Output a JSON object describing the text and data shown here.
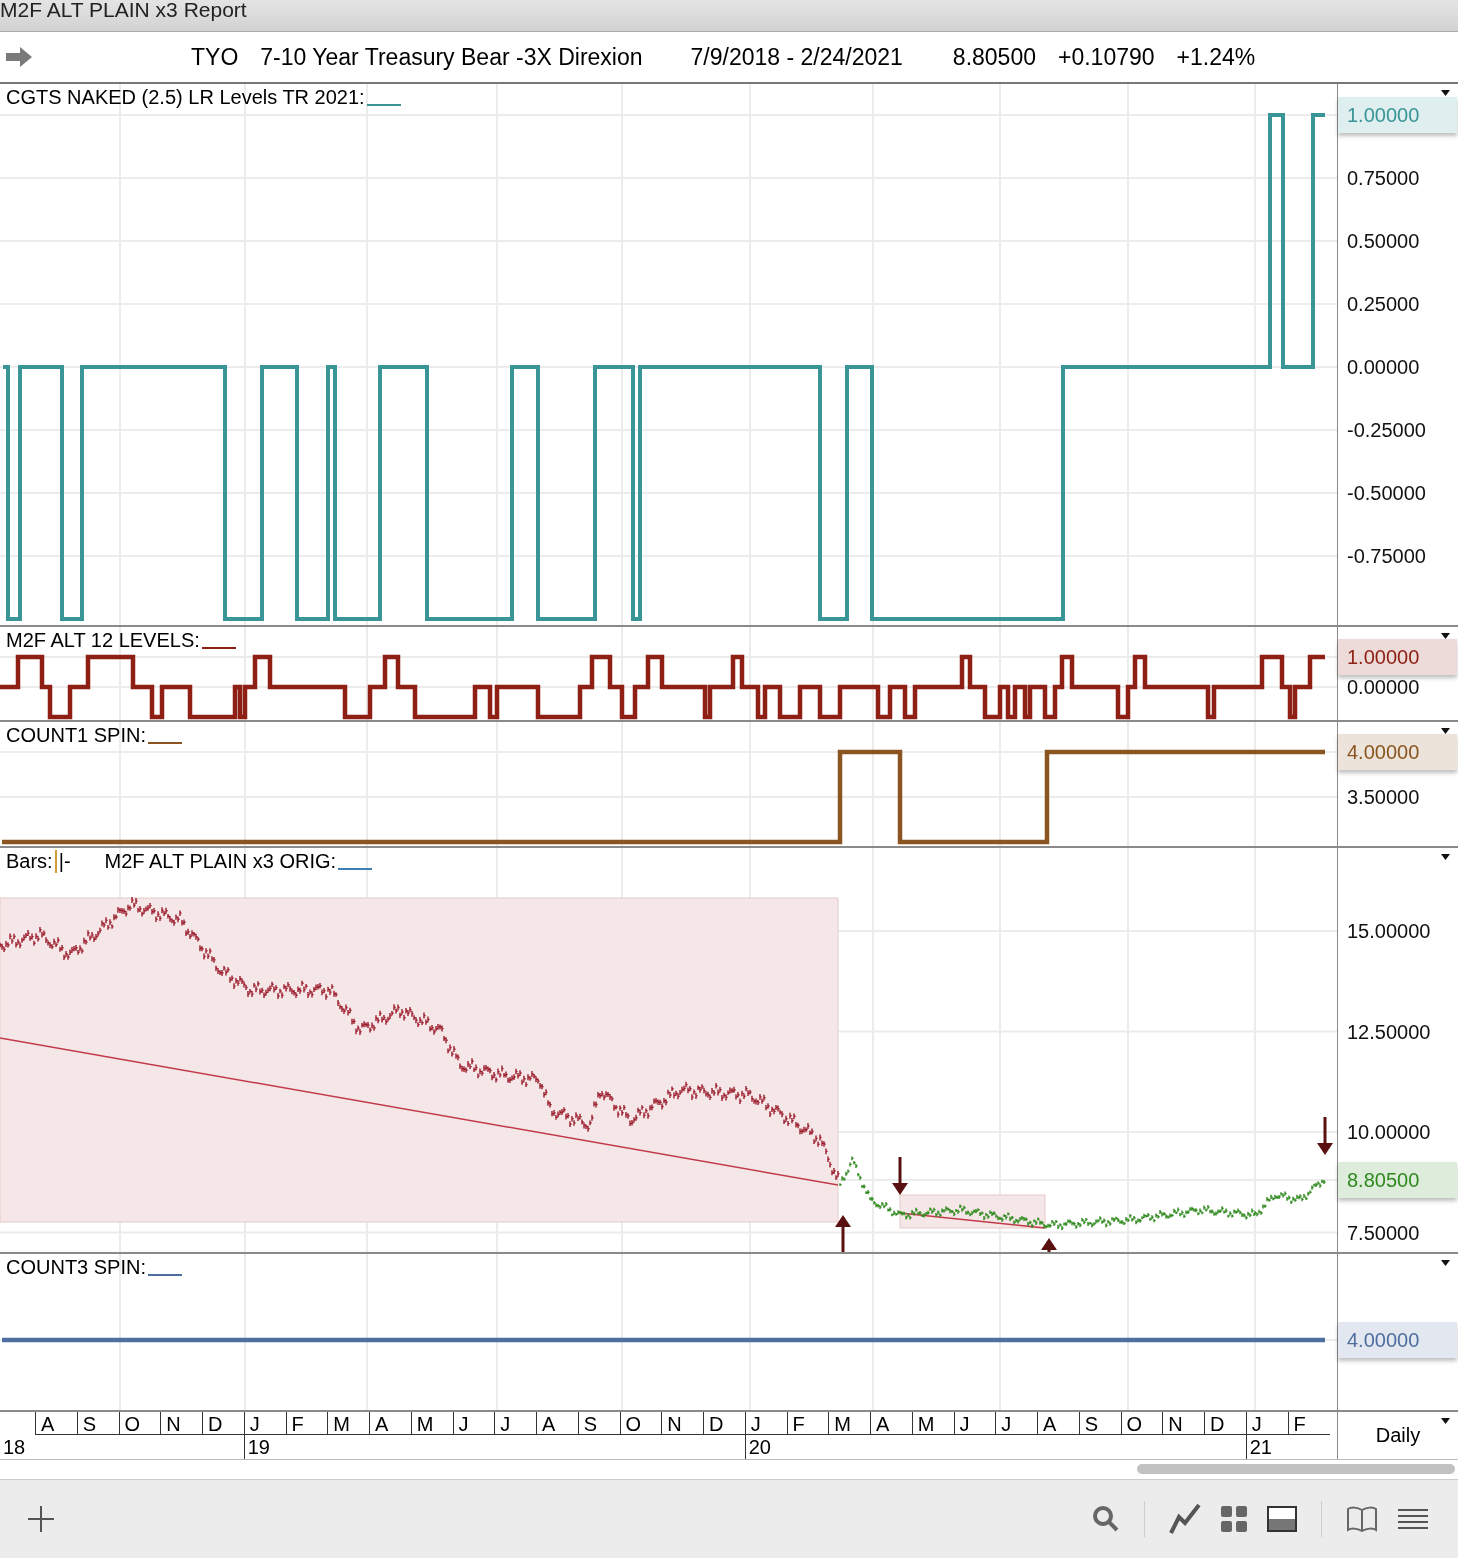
{
  "window": {
    "title": "M2F ALT PLAIN x3 Report"
  },
  "header": {
    "symbol": "TYO",
    "name": "7-10 Year Treasury Bear -3X Direxion",
    "range": "7/9/2018 - 2/24/2021",
    "last": "8.80500",
    "change": "+0.10790",
    "change_pct": "+1.24%"
  },
  "panels": [
    {
      "kind": "step",
      "title": "CGTS NAKED (2.5) LR Levels TR 2021:",
      "color": "#3a9696",
      "ticks": [
        {
          "label": "1.00000",
          "highlighted": true
        },
        {
          "label": "0.75000",
          "highlighted": false
        },
        {
          "label": "0.50000",
          "highlighted": false
        },
        {
          "label": "0.25000",
          "highlighted": false
        },
        {
          "label": "0.00000",
          "highlighted": false
        },
        {
          "label": "-0.25000",
          "highlighted": false
        },
        {
          "label": "-0.50000",
          "highlighted": false
        },
        {
          "label": "-0.75000",
          "highlighted": false
        }
      ]
    },
    {
      "kind": "step",
      "title": "M2F ALT 12 LEVELS:",
      "color": "#8e1f14",
      "ticks": [
        {
          "label": "1.00000",
          "highlighted": true
        },
        {
          "label": "0.00000",
          "highlighted": false
        }
      ]
    },
    {
      "kind": "step",
      "title": "COUNT1 SPIN:",
      "color": "#8a5520",
      "ticks": [
        {
          "label": "4.00000",
          "highlighted": true
        },
        {
          "label": "3.50000",
          "highlighted": false
        }
      ]
    },
    {
      "kind": "price",
      "bars_label": "Bars:",
      "bars_symbol": "|-",
      "title": "M2F ALT PLAIN x3 ORIG:",
      "color": "#3d7fb5",
      "ticks": [
        {
          "label": "15.00000",
          "highlighted": false
        },
        {
          "label": "12.50000",
          "highlighted": false
        },
        {
          "label": "10.00000",
          "highlighted": false
        },
        {
          "label": "8.80500",
          "highlighted": true
        },
        {
          "label": "7.50000",
          "highlighted": false
        }
      ]
    },
    {
      "kind": "step",
      "title": "COUNT3 SPIN:",
      "color": "#4f6ea0",
      "ticks": [
        {
          "label": "4.00000",
          "highlighted": true
        }
      ]
    }
  ],
  "time_axis": {
    "months": [
      "A",
      "S",
      "O",
      "N",
      "D",
      "J",
      "F",
      "M",
      "A",
      "M",
      "J",
      "J",
      "A",
      "S",
      "O",
      "N",
      "D",
      "J",
      "F",
      "M",
      "A",
      "M",
      "J",
      "J",
      "A",
      "S",
      "O",
      "N",
      "D",
      "J",
      "F"
    ],
    "years": [
      "18",
      "19",
      "20",
      "21"
    ],
    "interval": "Daily"
  }
}
